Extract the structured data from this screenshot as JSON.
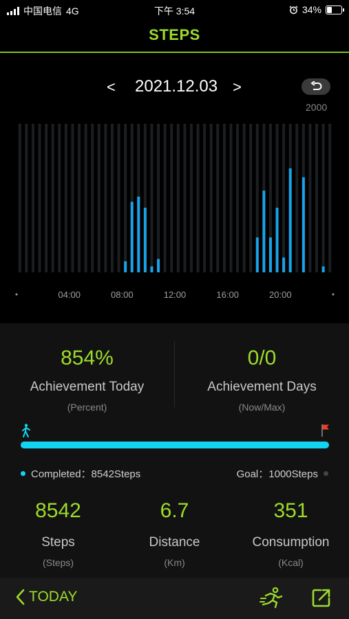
{
  "status": {
    "carrier": "中国电信",
    "network": "4G",
    "time": "下午 3:54",
    "battery_text": "34%",
    "battery_level": 0.34
  },
  "header": {
    "title": "STEPS"
  },
  "date_nav": {
    "prev": "<",
    "date": "2021.12.03",
    "next": ">",
    "scale_max": "2000"
  },
  "chart_data": {
    "type": "bar",
    "ymax": 2000,
    "x_tick_labels": [
      "04:00",
      "08:00",
      "12:00",
      "16:00",
      "20:00"
    ],
    "slot_count": 48,
    "values": [
      0,
      0,
      0,
      0,
      0,
      0,
      0,
      0,
      0,
      0,
      0,
      0,
      0,
      0,
      0,
      0,
      150,
      950,
      1020,
      870,
      80,
      180,
      0,
      0,
      0,
      0,
      0,
      0,
      0,
      0,
      0,
      0,
      0,
      0,
      0,
      0,
      470,
      1100,
      470,
      870,
      200,
      1400,
      0,
      1280,
      0,
      0,
      80,
      0
    ],
    "colors": {
      "bar": "#1aa3e8",
      "track": "#1c1f21"
    }
  },
  "achievement": {
    "today_value": "854%",
    "today_label": "Achievement Today",
    "today_sub": "(Percent)",
    "days_value": "0/0",
    "days_label": "Achievement Days",
    "days_sub": "(Now/Max)"
  },
  "progress": {
    "fraction": 1.0
  },
  "summary": {
    "completed": "Completed：8542Steps",
    "goal": "Goal：1000Steps"
  },
  "stats": [
    {
      "value": "8542",
      "label": "Steps",
      "unit": "(Steps)"
    },
    {
      "value": "6.7",
      "label": "Distance",
      "unit": "(Km)"
    },
    {
      "value": "351",
      "label": "Consumption",
      "unit": "(Kcal)"
    }
  ],
  "bottom": {
    "today": "TODAY"
  },
  "colors": {
    "accent": "#9ddc2b",
    "cyan": "#12d4f2"
  }
}
